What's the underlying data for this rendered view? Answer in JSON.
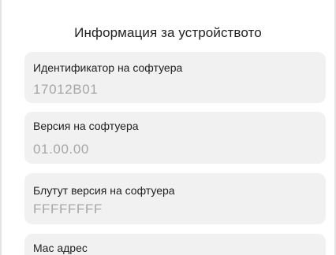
{
  "header": {
    "title": "Информация за устройството"
  },
  "items": [
    {
      "label": "Идентификатор на софтуера",
      "value": "17012B01"
    },
    {
      "label": "Версия на софтуера",
      "value": "01.00.00"
    },
    {
      "label": "Блутут версия на софтуера",
      "value": "FFFFFFFF"
    },
    {
      "label": "Mac адрес",
      "value": ""
    }
  ]
}
